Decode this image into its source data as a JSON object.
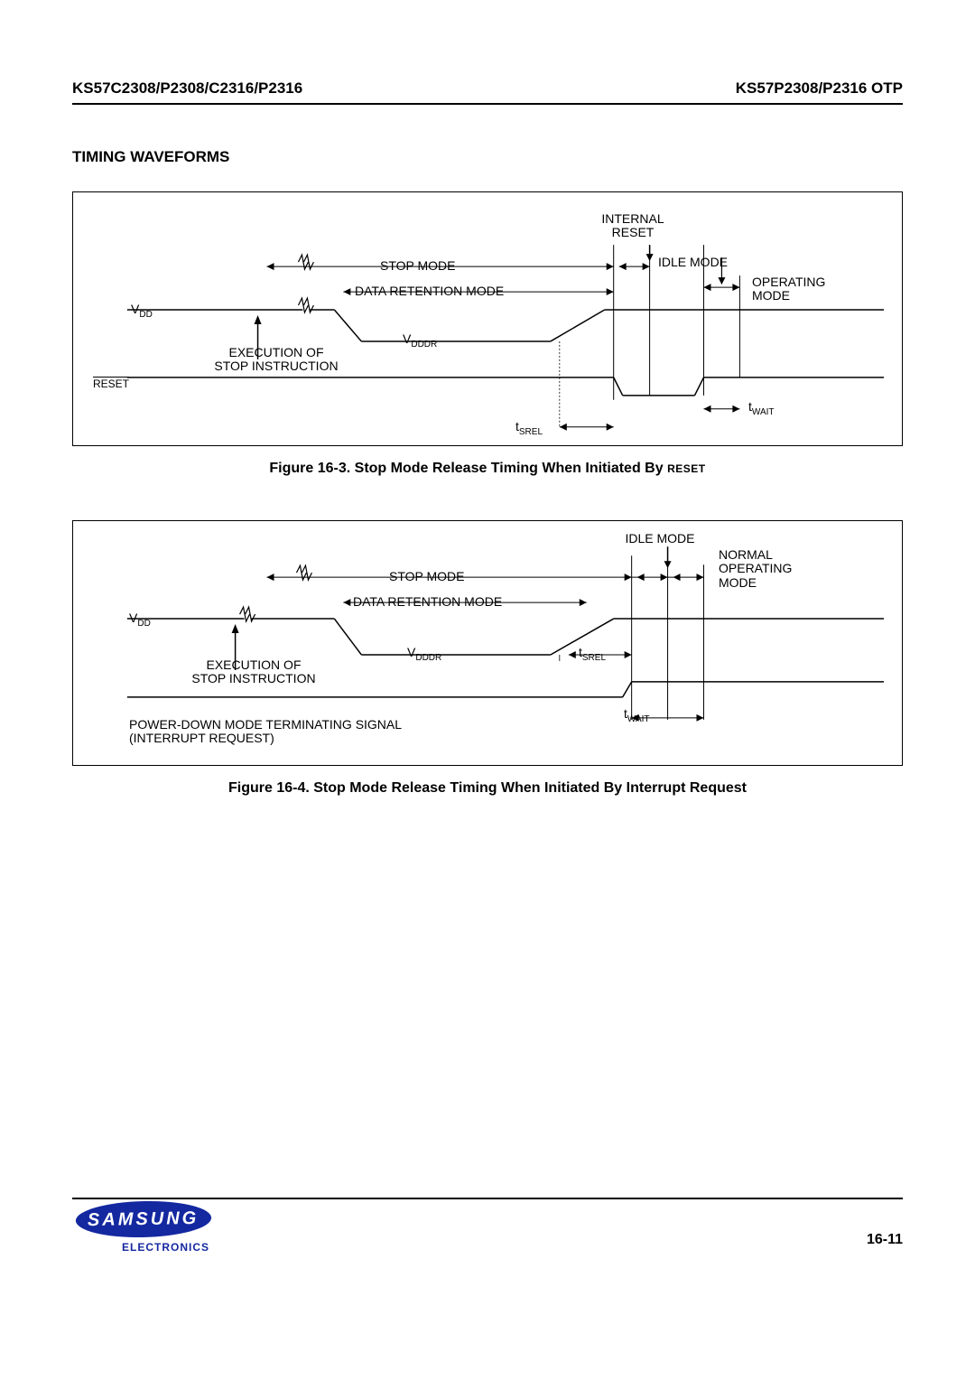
{
  "header": {
    "left": "KS57C2308/P2308/C2316/P2316",
    "right": "KS57P2308/P2316 OTP"
  },
  "section_title": "TIMING WAVEFORMS",
  "figure1": {
    "caption_prefix": "Figure 16-3. Stop Mode Release Timing When Initiated By ",
    "caption_reset": "RESET",
    "labels": {
      "internal_reset": "INTERNAL\nRESET",
      "stop_mode": "STOP MODE",
      "idle_mode": "IDLE MODE",
      "operating_mode": "OPERATING\nMODE",
      "data_retention": "DATA RETENTION  MODE",
      "vdd_prefix": "V",
      "vdd_sub": "DD",
      "vdddr_prefix": "V",
      "vdddr_sub": "DDDR",
      "execution": "EXECUTION OF\nSTOP INSTRUCTION",
      "reset_bar": "RESET",
      "twait_prefix": "t",
      "twait_sub": "WAIT",
      "tsrel_prefix": "t",
      "tsrel_sub": "SREL"
    }
  },
  "figure2": {
    "caption": "Figure 16-4. Stop Mode Release Timing When Initiated By Interrupt Request",
    "labels": {
      "idle_mode": "IDLE MODE",
      "normal_op": "NORMAL\nOPERATING\nMODE",
      "stop_mode": "STOP MODE",
      "data_retention": "DATA RETENTION  MODE",
      "vdd_prefix": "V",
      "vdd_sub": "DD",
      "vdddr_prefix": "V",
      "vdddr_sub": "DDDR",
      "execution": "EXECUTION OF\nSTOP INSTRUCTION",
      "tsrel_prefix": "t",
      "tsrel_sub": "SREL",
      "twait_prefix": "t",
      "twait_sub": "WAIT",
      "powerdown": "POWER-DOWN MODE TERMINATING SIGNAL\n(INTERRUPT REQUEST)"
    }
  },
  "footer": {
    "logo_text": "SAMSUNG",
    "electronics": "ELECTRONICS",
    "page_number": "16-11"
  }
}
